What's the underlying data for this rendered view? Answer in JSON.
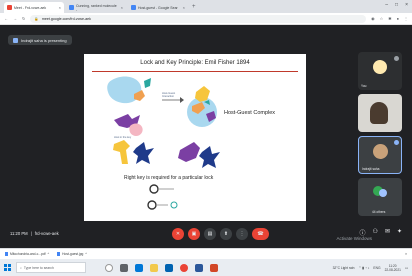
{
  "browser": {
    "tabs": [
      {
        "label": "Meet - Frd-vcwe-aek",
        "color": "#ea4335",
        "active": true
      },
      {
        "label": "Cunning, ranked molecule -",
        "color": "#4285f4",
        "active": false
      },
      {
        "label": "Host-guest - Google Sear",
        "color": "#4285f4",
        "active": false
      }
    ],
    "url": "meet.google.com/frd-vcwe-aek"
  },
  "meet": {
    "presenting_label": "Indrajit saha is presenting",
    "time": "11:20 PM",
    "separator": "|",
    "meeting_code": "frd-vcwe-aek",
    "activate_text": "Activate Windows"
  },
  "slide": {
    "title": "Lock and Key  Principle:  Emil Fisher 1894",
    "host_guest_label": "Host-Guest Complex",
    "right_key_label": "Right key is required for  a particular lock",
    "small_label_1": "Host-Guest",
    "small_label_2": "Interaction",
    "small_label_3": "Host in the key"
  },
  "participants": [
    {
      "name": "You"
    },
    {
      "name": ""
    },
    {
      "name": "Indrajit saha"
    },
    {
      "name": "44 others"
    }
  ],
  "downloads": [
    {
      "label": "Mitochondria-and-c...pdf"
    },
    {
      "label": "Host-guest.jpg"
    }
  ],
  "taskbar": {
    "search_placeholder": "Type here to search",
    "tray_text": "32°C  Light rain",
    "lang": "ENG",
    "time": "11:20",
    "date": "22-08-2021"
  },
  "colors": {
    "meet_bg": "#202124",
    "tile_bg": "#3c4043",
    "end_call": "#ea4335",
    "slide_rule": "#c0392b"
  }
}
